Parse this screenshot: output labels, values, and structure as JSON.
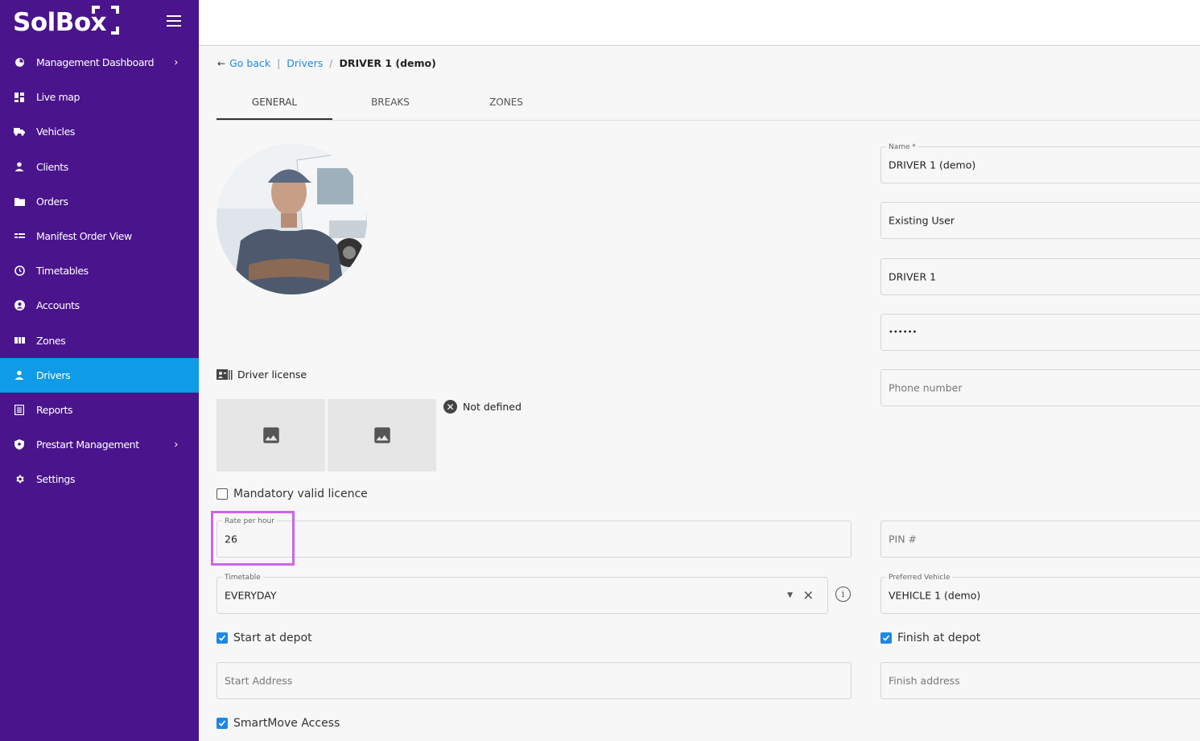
{
  "brand": {
    "name": "SolBox"
  },
  "sidebar": {
    "items": [
      {
        "label": "Management Dashboard",
        "icon": "dashboard-icon",
        "has_chevron": true
      },
      {
        "label": "Live map",
        "icon": "grid-icon"
      },
      {
        "label": "Vehicles",
        "icon": "truck-icon"
      },
      {
        "label": "Clients",
        "icon": "person-icon"
      },
      {
        "label": "Orders",
        "icon": "folder-icon"
      },
      {
        "label": "Manifest Order View",
        "icon": "list-icon"
      },
      {
        "label": "Timetables",
        "icon": "clock-icon"
      },
      {
        "label": "Accounts",
        "icon": "account-circle-icon"
      },
      {
        "label": "Zones",
        "icon": "map-icon"
      },
      {
        "label": "Drivers",
        "icon": "person-icon",
        "active": true
      },
      {
        "label": "Reports",
        "icon": "report-icon"
      },
      {
        "label": "Prestart Management",
        "icon": "shield-icon",
        "has_chevron": true
      },
      {
        "label": "Settings",
        "icon": "gear-icon"
      }
    ]
  },
  "breadcrumb": {
    "back": "Go back",
    "parent": "Drivers",
    "current": "DRIVER 1 (demo)"
  },
  "tabs": [
    {
      "label": "GENERAL",
      "active": true
    },
    {
      "label": "BREAKS"
    },
    {
      "label": "ZONES"
    }
  ],
  "license": {
    "title": "Driver license",
    "status": "Not defined"
  },
  "form": {
    "mandatory_licence": {
      "label": "Mandatory valid licence",
      "checked": false
    },
    "name": {
      "label": "Name *",
      "value": "DRIVER 1 (demo)"
    },
    "user_type": {
      "value": "Existing User"
    },
    "username": {
      "value": "DRIVER 1"
    },
    "password": {
      "value": "••••••"
    },
    "phone": {
      "placeholder": "Phone number"
    },
    "rate": {
      "label": "Rate per hour",
      "value": "26"
    },
    "pin": {
      "placeholder": "PIN #"
    },
    "timetable": {
      "label": "Timetable",
      "value": "EVERYDAY"
    },
    "preferred_vehicle": {
      "label": "Preferred Vehicle",
      "value": "VEHICLE 1 (demo)"
    },
    "start_at_depot": {
      "label": "Start at depot",
      "checked": true
    },
    "finish_at_depot": {
      "label": "Finish at depot",
      "checked": true
    },
    "start_address": {
      "placeholder": "Start Address"
    },
    "finish_address": {
      "placeholder": "Finish address"
    },
    "smartmove": {
      "label": "SmartMove Access",
      "checked": true
    }
  },
  "colors": {
    "sidebar": "#4a148c",
    "active": "#0f9be5",
    "link": "#1e88e5",
    "highlight": "#cc66e6"
  }
}
